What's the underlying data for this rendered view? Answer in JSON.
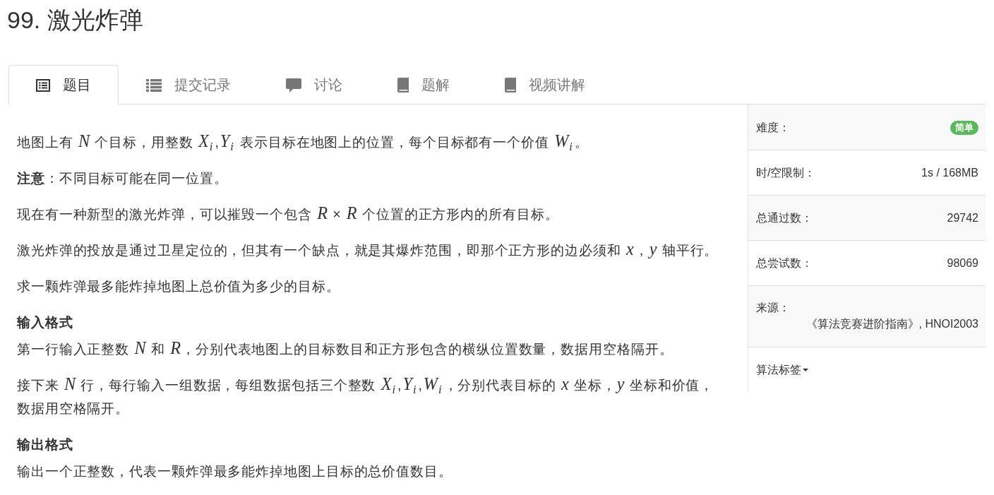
{
  "title": "99. 激光炸弹",
  "tabs": [
    {
      "label": "题目",
      "selected": true
    },
    {
      "label": "提交记录",
      "selected": false
    },
    {
      "label": "讨论",
      "selected": false
    },
    {
      "label": "题解",
      "selected": false
    },
    {
      "label": "视频讲解",
      "selected": false
    }
  ],
  "content": [
    {
      "kind": "paragraph",
      "text": "地图上有 *N* 个目标，用整数 *X*$_{i}$,*Y*$_{i}$ 表示目标在地图上的位置，每个目标都有一个价值 *W*$_{i}$。"
    },
    {
      "kind": "paragraph",
      "text": "**注意**：不同目标可能在同一位置。"
    },
    {
      "kind": "paragraph",
      "text": "现在有一种新型的激光炸弹，可以摧毁一个包含 *R* × *R* 个位置的正方形内的所有目标。"
    },
    {
      "kind": "paragraph",
      "text": "激光炸弹的投放是通过卫星定位的，但其有一个缺点，就是其爆炸范围，即那个正方形的边必须和 *x*，*y* 轴平行。"
    },
    {
      "kind": "paragraph",
      "text": "求一颗炸弹最多能炸掉地图上总价值为多少的目标。"
    },
    {
      "kind": "heading",
      "text": "输入格式"
    },
    {
      "kind": "paragraph",
      "text": "第一行输入正整数 *N* 和 *R*，分别代表地图上的目标数目和正方形包含的横纵位置数量，数据用空格隔开。"
    },
    {
      "kind": "paragraph",
      "text": "接下来 *N* 行，每行输入一组数据，每组数据包括三个整数 *X*$_{i}$,*Y*$_{i}$,*W*$_{i}$，分别代表目标的 *x* 坐标，*y* 坐标和价值，数据用空格隔开。"
    },
    {
      "kind": "heading",
      "text": "输出格式"
    },
    {
      "kind": "paragraph",
      "text": "输出一个正整数，代表一颗炸弹最多能炸掉地图上目标的总价值数目。"
    }
  ],
  "info": [
    {
      "kind": "badge",
      "label": "难度：",
      "value": "简单"
    },
    {
      "kind": "text",
      "label": "时/空限制：",
      "value": "1s / 168MB"
    },
    {
      "kind": "text",
      "label": "总通过数：",
      "value": "29742"
    },
    {
      "kind": "text",
      "label": "总尝试数：",
      "value": "98069"
    },
    {
      "kind": "stacked",
      "label": "来源：",
      "value": "《算法竞赛进阶指南》, HNOI2003"
    },
    {
      "kind": "dropdown",
      "label": "算法标签"
    }
  ]
}
